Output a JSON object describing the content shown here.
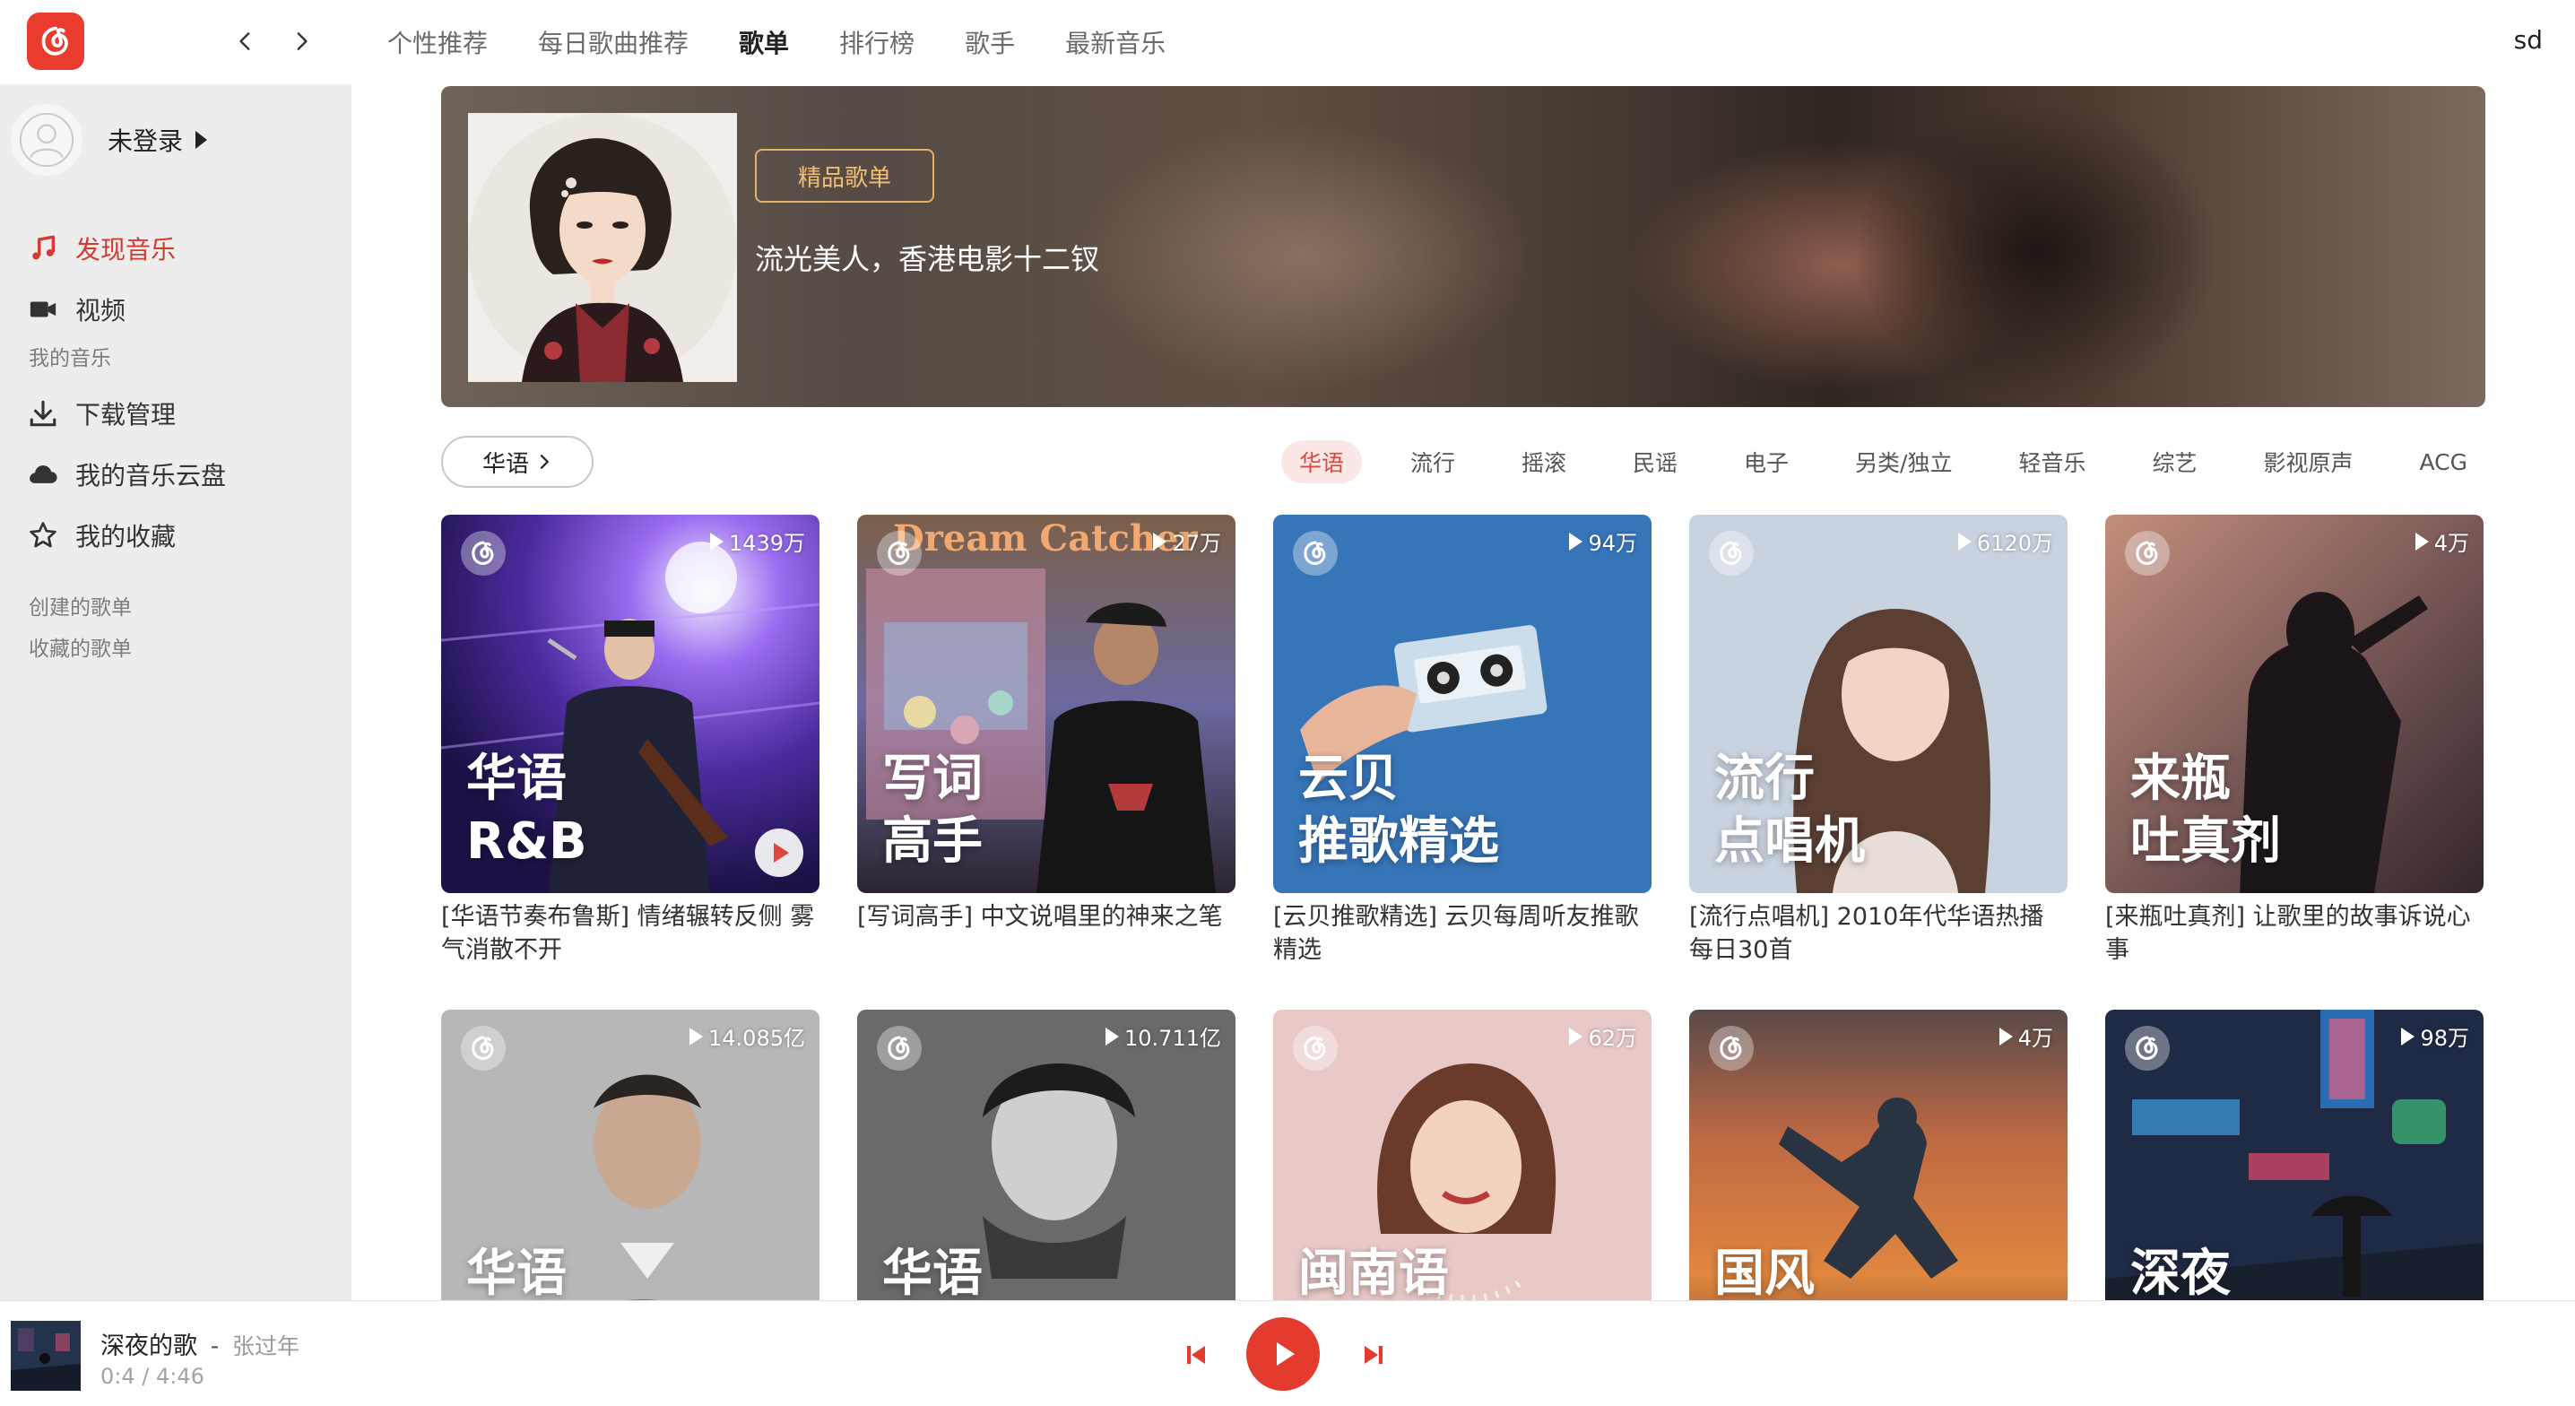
{
  "top": {
    "tabs": [
      "个性推荐",
      "每日歌曲推荐",
      "歌单",
      "排行榜",
      "歌手",
      "最新音乐"
    ],
    "active_tab": "歌单",
    "user": "sd"
  },
  "sidebar": {
    "login_label": "未登录",
    "items_main": [
      {
        "label": "发现音乐",
        "icon": "music-note-icon",
        "active": true
      },
      {
        "label": "视频",
        "icon": "video-camera-icon",
        "active": false
      }
    ],
    "section_my_music": "我的音乐",
    "items_my": [
      {
        "label": "下载管理",
        "icon": "download-icon"
      },
      {
        "label": "我的音乐云盘",
        "icon": "cloud-icon"
      },
      {
        "label": "我的收藏",
        "icon": "star-icon"
      }
    ],
    "section_created": "创建的歌单",
    "section_collected": "收藏的歌单"
  },
  "banner": {
    "tag": "精品歌单",
    "description": "流光美人，香港电影十二钗"
  },
  "categories": {
    "selected": "华语",
    "tags": [
      "华语",
      "流行",
      "摇滚",
      "民谣",
      "电子",
      "另类/独立",
      "轻音乐",
      "综艺",
      "影视原声",
      "ACG"
    ],
    "active_tag": "华语"
  },
  "playlists": [
    {
      "plays": "1439万",
      "cover_text": [
        "华语",
        "R&B"
      ],
      "title": "[华语节奏布鲁斯] 情绪辗转反侧 雾气消散不开"
    },
    {
      "plays": "27万",
      "cover_text": [
        "写词",
        "高手"
      ],
      "title": "[写词高手] 中文说唱里的神来之笔"
    },
    {
      "plays": "94万",
      "cover_text": [
        "云贝",
        "推歌精选"
      ],
      "title": "[云贝推歌精选] 云贝每周听友推歌精选"
    },
    {
      "plays": "6120万",
      "cover_text": [
        "流行",
        "点唱机"
      ],
      "title": "[流行点唱机] 2010年代华语热播每日30首"
    },
    {
      "plays": "4万",
      "cover_text": [
        "来瓶",
        "吐真剂"
      ],
      "title": "[来瓶吐真剂] 让歌里的故事诉说心事"
    },
    {
      "plays": "14.085亿",
      "cover_text": [
        "华语"
      ],
      "title": ""
    },
    {
      "plays": "10.711亿",
      "cover_text": [
        "华语"
      ],
      "title": ""
    },
    {
      "plays": "62万",
      "cover_text": [
        "闽南语"
      ],
      "title": ""
    },
    {
      "plays": "4万",
      "cover_text": [
        "国风"
      ],
      "title": ""
    },
    {
      "plays": "98万",
      "cover_text": [
        "深夜"
      ],
      "title": ""
    }
  ],
  "player": {
    "song": "深夜的歌",
    "dash": "-",
    "artist": "张过年",
    "time": "0:4 / 4:46"
  },
  "colors": {
    "accent": "#e33b2e",
    "active_text": "#d33a31",
    "sidebar_bg": "#ededed",
    "banner_tag": "#e6b06a"
  }
}
